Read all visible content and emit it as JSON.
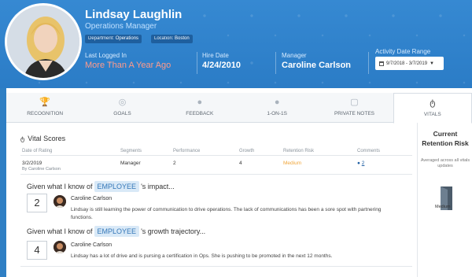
{
  "profile": {
    "name": "Lindsay Laughlin",
    "title": "Operations Manager",
    "department_label": "Department:",
    "department": "Operations",
    "location_label": "Location:",
    "location": "Boston"
  },
  "stats": {
    "last_login_label": "Last Logged In",
    "last_login_value": "More Than A Year Ago",
    "hire_label": "Hire Date",
    "hire_value": "4/24/2010",
    "manager_label": "Manager",
    "manager_value": "Caroline Carlson"
  },
  "activity": {
    "label": "Activity Date Range",
    "range": "9/7/2018 - 3/7/2019"
  },
  "tabs": [
    {
      "label": "RECOGNITION",
      "icon": "trophy-icon"
    },
    {
      "label": "GOALS",
      "icon": "target-icon"
    },
    {
      "label": "FEEDBACK",
      "icon": "speech-bubble-icon"
    },
    {
      "label": "1-ON-1S",
      "icon": "chat-bubbles-icon"
    },
    {
      "label": "PRIVATE NOTES",
      "icon": "note-icon"
    },
    {
      "label": "VITALS",
      "icon": "stethoscope-icon"
    }
  ],
  "active_tab": "VITALS",
  "vital_scores": {
    "heading": "Vital Scores",
    "columns": [
      "Date of Rating",
      "Segments",
      "Performance",
      "Growth",
      "Retention Risk",
      "Comments"
    ],
    "row": {
      "date": "3/2/2019",
      "by": "By Caroline Carlson",
      "segment": "Manager",
      "performance": "2",
      "growth": "4",
      "retention_risk": "Medium",
      "comments": "2"
    }
  },
  "questions": [
    {
      "prefix": "Given what I know of",
      "tag": "EMPLOYEE",
      "suffix": "'s impact...",
      "score": "2",
      "rater": "Caroline Carlson",
      "comment": "Lindsay is still learning the power of communication to drive operations. The lack of communications has been a sore spot with partnering functions."
    },
    {
      "prefix": "Given what I know of",
      "tag": "EMPLOYEE",
      "suffix": "'s growth trajectory...",
      "score": "4",
      "rater": "Caroline Carlson",
      "comment": "Lindsay has a lot of drive and is pursing a certification in Ops. She is pushing to be promoted in the next 12 months."
    }
  ],
  "retention": {
    "title": "Current Retention Risk",
    "subtitle": "Averaged across all vitals updates",
    "level": "Medium"
  },
  "colors": {
    "header_blue": "#2f7fc4",
    "login_red": "#ff9a8a",
    "medium_orange": "#f0a63b",
    "employee_tag_bg": "#d9e9f7"
  }
}
